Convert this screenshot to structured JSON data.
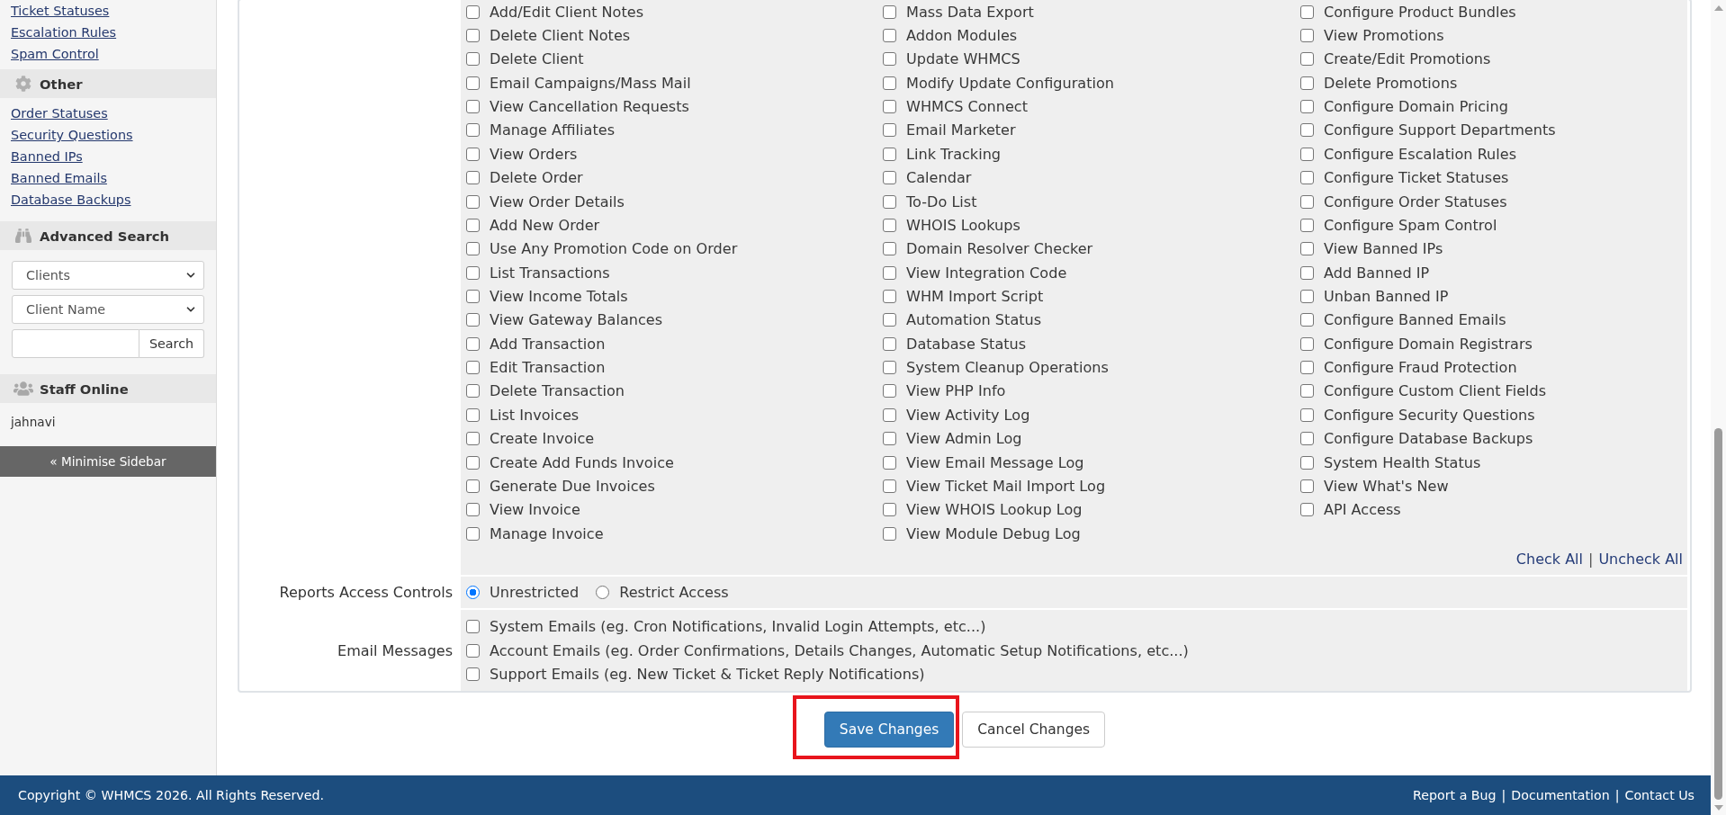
{
  "sidebar": {
    "top_links": [
      "Ticket Statuses",
      "Escalation Rules",
      "Spam Control"
    ],
    "other": {
      "title": "Other",
      "links": [
        "Order Statuses",
        "Security Questions",
        "Banned IPs",
        "Banned Emails",
        "Database Backups"
      ]
    },
    "advanced_search": {
      "title": "Advanced Search",
      "type_select": "Clients",
      "field_select": "Client Name",
      "search_button": "Search"
    },
    "staff_online": {
      "title": "Staff Online",
      "users": [
        "jahnavi"
      ]
    },
    "minimise_button": "« Minimise Sidebar"
  },
  "permissions": {
    "columns": [
      {
        "items": [
          {
            "label": "Add/Edit Client Notes",
            "checked": false
          },
          {
            "label": "Delete Client Notes",
            "checked": false
          },
          {
            "label": "Delete Client",
            "checked": false
          },
          {
            "label": "Email Campaigns/Mass Mail",
            "checked": false
          },
          {
            "label": "View Cancellation Requests",
            "checked": false
          },
          {
            "label": "Manage Affiliates",
            "checked": false
          },
          {
            "label": "View Orders",
            "checked": false
          },
          {
            "label": "Delete Order",
            "checked": false
          },
          {
            "label": "View Order Details",
            "checked": false
          },
          {
            "label": "Add New Order",
            "checked": false
          },
          {
            "label": "Use Any Promotion Code on Order",
            "checked": false
          },
          {
            "label": "List Transactions",
            "checked": false
          },
          {
            "label": "View Income Totals",
            "checked": false
          },
          {
            "label": "View Gateway Balances",
            "checked": false
          },
          {
            "label": "Add Transaction",
            "checked": false
          },
          {
            "label": "Edit Transaction",
            "checked": false
          },
          {
            "label": "Delete Transaction",
            "checked": false
          },
          {
            "label": "List Invoices",
            "checked": false
          },
          {
            "label": "Create Invoice",
            "checked": false
          },
          {
            "label": "Create Add Funds Invoice",
            "checked": false
          },
          {
            "label": "Generate Due Invoices",
            "checked": false
          },
          {
            "label": "View Invoice",
            "checked": false
          },
          {
            "label": "Manage Invoice",
            "checked": false
          }
        ]
      },
      {
        "items": [
          {
            "label": "Mass Data Export",
            "checked": false
          },
          {
            "label": "Addon Modules",
            "checked": false
          },
          {
            "label": "Update WHMCS",
            "checked": false
          },
          {
            "label": "Modify Update Configuration",
            "checked": false
          },
          {
            "label": "WHMCS Connect",
            "checked": false
          },
          {
            "label": "Email Marketer",
            "checked": false
          },
          {
            "label": "Link Tracking",
            "checked": false
          },
          {
            "label": "Calendar",
            "checked": false
          },
          {
            "label": "To-Do List",
            "checked": false
          },
          {
            "label": "WHOIS Lookups",
            "checked": false
          },
          {
            "label": "Domain Resolver Checker",
            "checked": false
          },
          {
            "label": "View Integration Code",
            "checked": false
          },
          {
            "label": "WHM Import Script",
            "checked": false
          },
          {
            "label": "Automation Status",
            "checked": false
          },
          {
            "label": "Database Status",
            "checked": false
          },
          {
            "label": "System Cleanup Operations",
            "checked": false
          },
          {
            "label": "View PHP Info",
            "checked": false
          },
          {
            "label": "View Activity Log",
            "checked": false
          },
          {
            "label": "View Admin Log",
            "checked": false
          },
          {
            "label": "View Email Message Log",
            "checked": false
          },
          {
            "label": "View Ticket Mail Import Log",
            "checked": false
          },
          {
            "label": "View WHOIS Lookup Log",
            "checked": false
          },
          {
            "label": "View Module Debug Log",
            "checked": false
          }
        ]
      },
      {
        "items": [
          {
            "label": "Configure Product Bundles",
            "checked": false
          },
          {
            "label": "View Promotions",
            "checked": false
          },
          {
            "label": "Create/Edit Promotions",
            "checked": false
          },
          {
            "label": "Delete Promotions",
            "checked": false
          },
          {
            "label": "Configure Domain Pricing",
            "checked": false
          },
          {
            "label": "Configure Support Departments",
            "checked": false
          },
          {
            "label": "Configure Escalation Rules",
            "checked": false
          },
          {
            "label": "Configure Ticket Statuses",
            "checked": false
          },
          {
            "label": "Configure Order Statuses",
            "checked": false
          },
          {
            "label": "Configure Spam Control",
            "checked": false
          },
          {
            "label": "View Banned IPs",
            "checked": false
          },
          {
            "label": "Add Banned IP",
            "checked": false
          },
          {
            "label": "Unban Banned IP",
            "checked": false
          },
          {
            "label": "Configure Banned Emails",
            "checked": false
          },
          {
            "label": "Configure Domain Registrars",
            "checked": false
          },
          {
            "label": "Configure Fraud Protection",
            "checked": false
          },
          {
            "label": "Configure Custom Client Fields",
            "checked": false
          },
          {
            "label": "Configure Security Questions",
            "checked": false
          },
          {
            "label": "Configure Database Backups",
            "checked": false
          },
          {
            "label": "System Health Status",
            "checked": false
          },
          {
            "label": "View What's New",
            "checked": false
          },
          {
            "label": "API Access",
            "checked": false
          }
        ]
      }
    ],
    "actions": [
      {
        "kind": "link",
        "text": "Check All"
      },
      {
        "kind": "separator",
        "text": "|"
      },
      {
        "kind": "link",
        "text": "Uncheck All"
      }
    ]
  },
  "reports_access": {
    "label": "Reports Access Controls",
    "options": [
      {
        "label": "Unrestricted",
        "selected": true
      },
      {
        "label": "Restrict Access",
        "selected": false
      }
    ]
  },
  "email_messages": {
    "label": "Email Messages",
    "options": [
      {
        "label": "System Emails (eg. Cron Notifications, Invalid Login Attempts, etc...)",
        "checked": false
      },
      {
        "label": "Account Emails (eg. Order Confirmations, Details Changes, Automatic Setup Notifications, etc...)",
        "checked": false
      },
      {
        "label": "Support Emails (eg. New Ticket & Ticket Reply Notifications)",
        "checked": false
      }
    ]
  },
  "buttons": [
    {
      "label": "Save Changes",
      "kind": "primary",
      "highlighted": true
    },
    {
      "label": "Cancel Changes",
      "kind": "default",
      "highlighted": false
    }
  ],
  "footer": {
    "copyright": "Copyright © WHMCS 2026. All Rights Reserved.",
    "links": [
      "Report a Bug",
      "Documentation",
      "Contact Us"
    ],
    "separators": [
      "|",
      "|"
    ]
  }
}
